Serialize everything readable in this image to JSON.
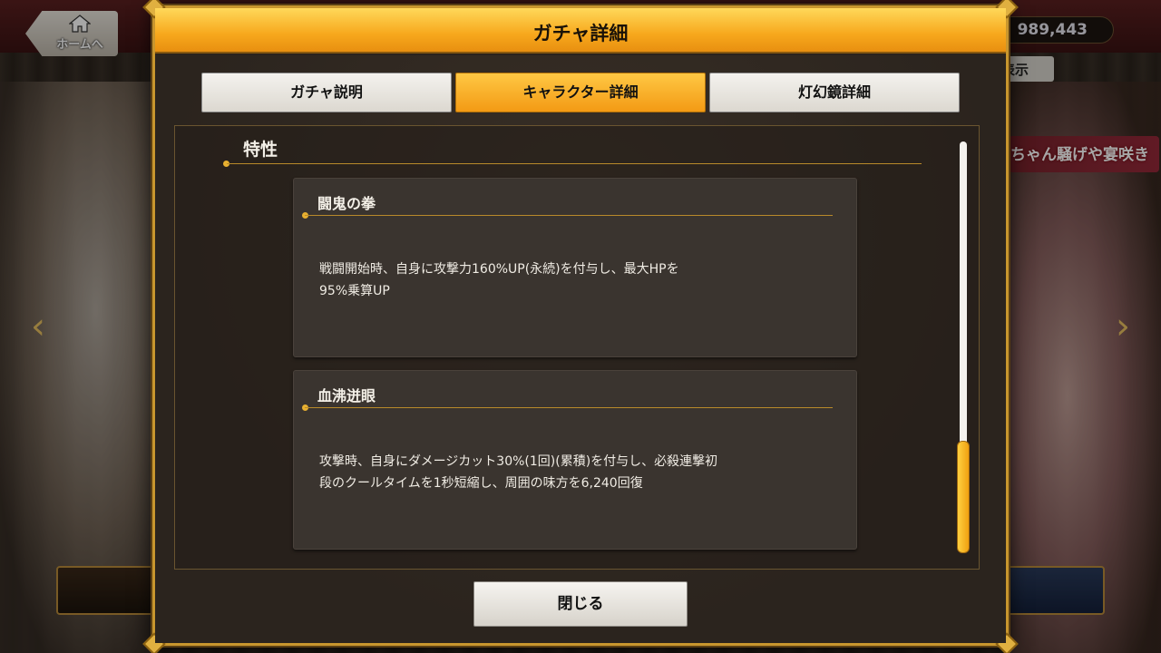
{
  "topbar": {
    "home_label": "ホームへ",
    "currency_value": "989,443",
    "display_label": "表示"
  },
  "right_banner": {
    "text": "ちゃん騒げや宴咲き"
  },
  "modal": {
    "title": "ガチャ詳細",
    "tabs": [
      {
        "label": "ガチャ説明",
        "active": false
      },
      {
        "label": "キャラクター詳細",
        "active": true
      },
      {
        "label": "灯幻鏡詳細",
        "active": false
      }
    ],
    "section_title": "特性",
    "traits": [
      {
        "name": "闘鬼の拳",
        "desc_lines": [
          "戦闘開始時、自身に攻撃力160%UP(永続)を付与し、最大HPを",
          "95%乗算UP"
        ]
      },
      {
        "name": "血沸迸眼",
        "desc_lines": [
          "攻撃時、自身にダメージカット30%(1回)(累積)を付与し、必殺連撃初",
          "段のクールタイムを1秒短縮し、周囲の味方を6,240回復"
        ]
      }
    ],
    "close_label": "閉じる"
  },
  "colors": {
    "accent_gold": "#f7a81c",
    "frame_gold": "#c8962e",
    "panel_bg": "#2b241e"
  }
}
